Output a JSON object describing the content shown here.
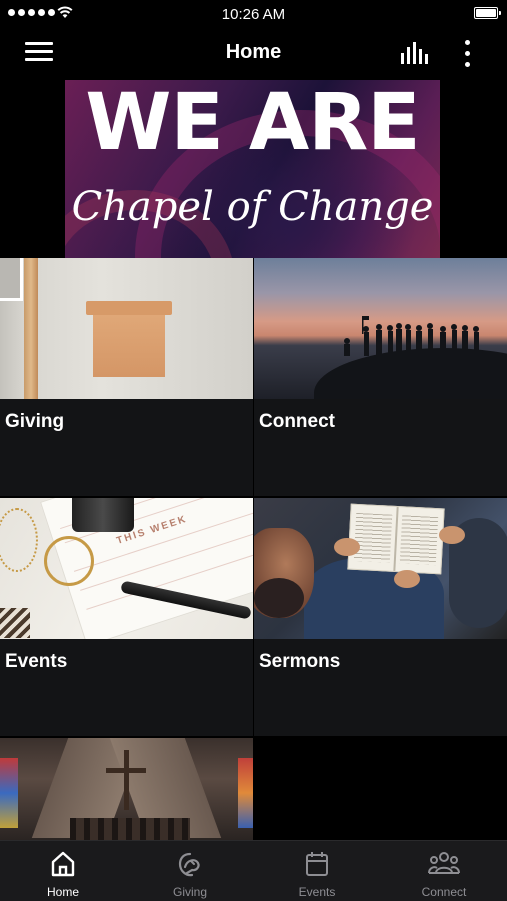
{
  "status_bar": {
    "time": "10:26 AM"
  },
  "nav": {
    "title": "Home"
  },
  "banner": {
    "title": "WE ARE",
    "script": "Chapel of Change"
  },
  "tiles": [
    {
      "label": "Giving"
    },
    {
      "label": "Connect"
    },
    {
      "label": "Events"
    },
    {
      "label": "Sermons"
    }
  ],
  "events_photo": {
    "paper_text": "THIS WEEK"
  },
  "tabbar": {
    "items": [
      {
        "label": "Home",
        "icon": "home-icon",
        "active": true
      },
      {
        "label": "Giving",
        "icon": "giving-icon",
        "active": false
      },
      {
        "label": "Events",
        "icon": "calendar-icon",
        "active": false
      },
      {
        "label": "Connect",
        "icon": "people-icon",
        "active": false
      }
    ]
  },
  "colors": {
    "background": "#000000",
    "tile_background": "#131416",
    "tabbar_background": "#1a1a1c",
    "active_tab": "#ffffff",
    "inactive_tab": "#8e8e93"
  }
}
